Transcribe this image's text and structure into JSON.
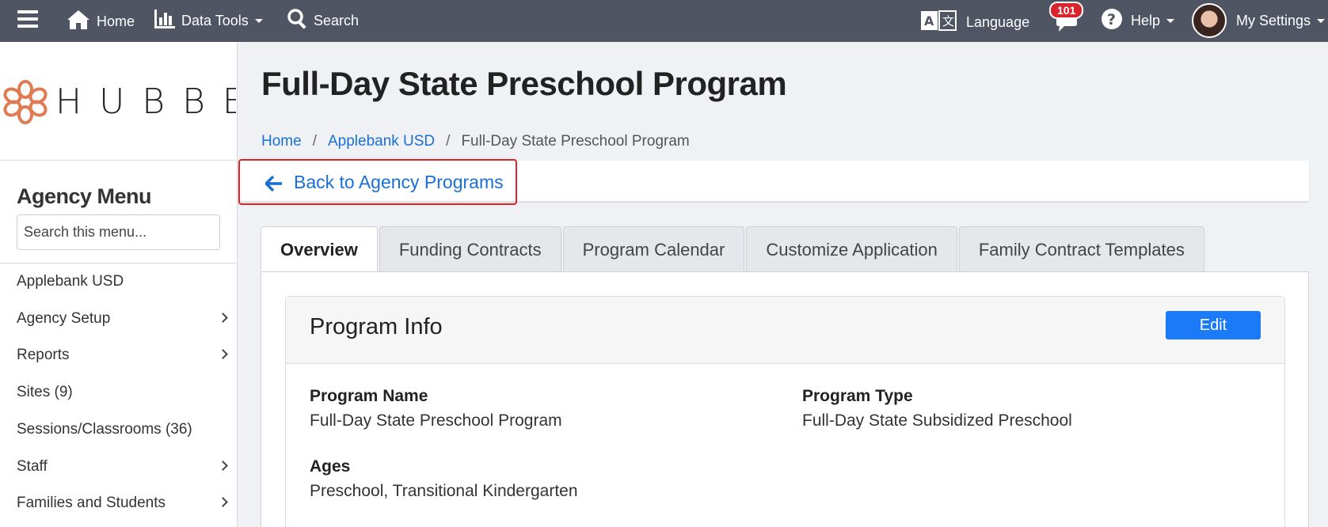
{
  "topbar": {
    "home_label": "Home",
    "data_tools_label": "Data Tools",
    "search_label": "Search",
    "language_label": "Language",
    "notification_count": "101",
    "help_label": "Help",
    "settings_label": "My Settings"
  },
  "sidebar": {
    "logo_text": "HUBBE",
    "menu_title": "Agency Menu",
    "search_placeholder": "Search this menu...",
    "items": [
      {
        "label": "Applebank USD",
        "has_children": false
      },
      {
        "label": "Agency Setup",
        "has_children": true
      },
      {
        "label": "Reports",
        "has_children": true
      },
      {
        "label": "Sites (9)",
        "has_children": false
      },
      {
        "label": "Sessions/Classrooms (36)",
        "has_children": false
      },
      {
        "label": "Staff",
        "has_children": true
      },
      {
        "label": "Families and Students",
        "has_children": true
      }
    ]
  },
  "header": {
    "title": "Full-Day State Preschool Program",
    "breadcrumb": [
      "Home",
      "Applebank USD",
      "Full-Day State Preschool Program"
    ]
  },
  "back_link": "Back to Agency Programs",
  "tabs": [
    "Overview",
    "Funding Contracts",
    "Program Calendar",
    "Customize Application",
    "Family Contract Templates"
  ],
  "card": {
    "title": "Program Info",
    "edit_label": "Edit",
    "fields": {
      "program_name_label": "Program Name",
      "program_name_value": "Full-Day State Preschool Program",
      "program_type_label": "Program Type",
      "program_type_value": "Full-Day State Subsidized Preschool",
      "ages_label": "Ages",
      "ages_value": "Preschool, Transitional Kindergarten"
    }
  },
  "colors": {
    "topbar": "#4f5563",
    "link": "#1a6fd6",
    "primary_button": "#1a7af8",
    "highlight_border": "#e0222b",
    "logo_accent": "#e07a52"
  }
}
